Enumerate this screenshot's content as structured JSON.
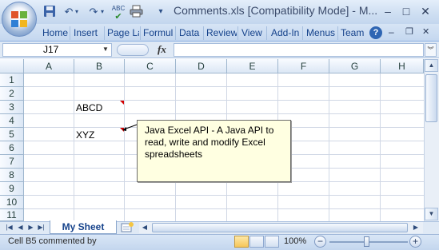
{
  "window": {
    "title": "Comments.xls  [Compatibility Mode] - M...",
    "minimize": "–",
    "maximize": "□",
    "close": "✕"
  },
  "qat": {
    "icons": [
      "save-icon",
      "undo-icon",
      "redo-icon",
      "spellcheck-icon",
      "print-icon",
      "customize-icon"
    ]
  },
  "ribbon": {
    "tabs": [
      "Home",
      "Insert",
      "Page La",
      "Formul",
      "Data",
      "Review",
      "View",
      "Add-In",
      "Menus",
      "Team"
    ],
    "help": "?"
  },
  "formula_bar": {
    "name_box": "J17",
    "fx": "fx",
    "content": ""
  },
  "sheet": {
    "columns": [
      "A",
      "B",
      "C",
      "D",
      "E",
      "F",
      "G",
      "H"
    ],
    "rows": [
      "1",
      "2",
      "3",
      "4",
      "5",
      "6",
      "7",
      "8",
      "9",
      "10",
      "11"
    ],
    "cells": {
      "B3": "ABCD",
      "B5": "XYZ"
    },
    "comment_text": "Java Excel API - A Java API to read, write and modify Excel spreadsheets"
  },
  "sheet_tabs": {
    "active": "My Sheet"
  },
  "status": {
    "text": "Cell B5 commented by",
    "zoom": "100%",
    "zoom_minus": "−",
    "zoom_plus": "+"
  },
  "colors": {
    "ribbon_text": "#15428b",
    "comment_bg": "#ffffe1",
    "comment_marker": "#d30000"
  }
}
